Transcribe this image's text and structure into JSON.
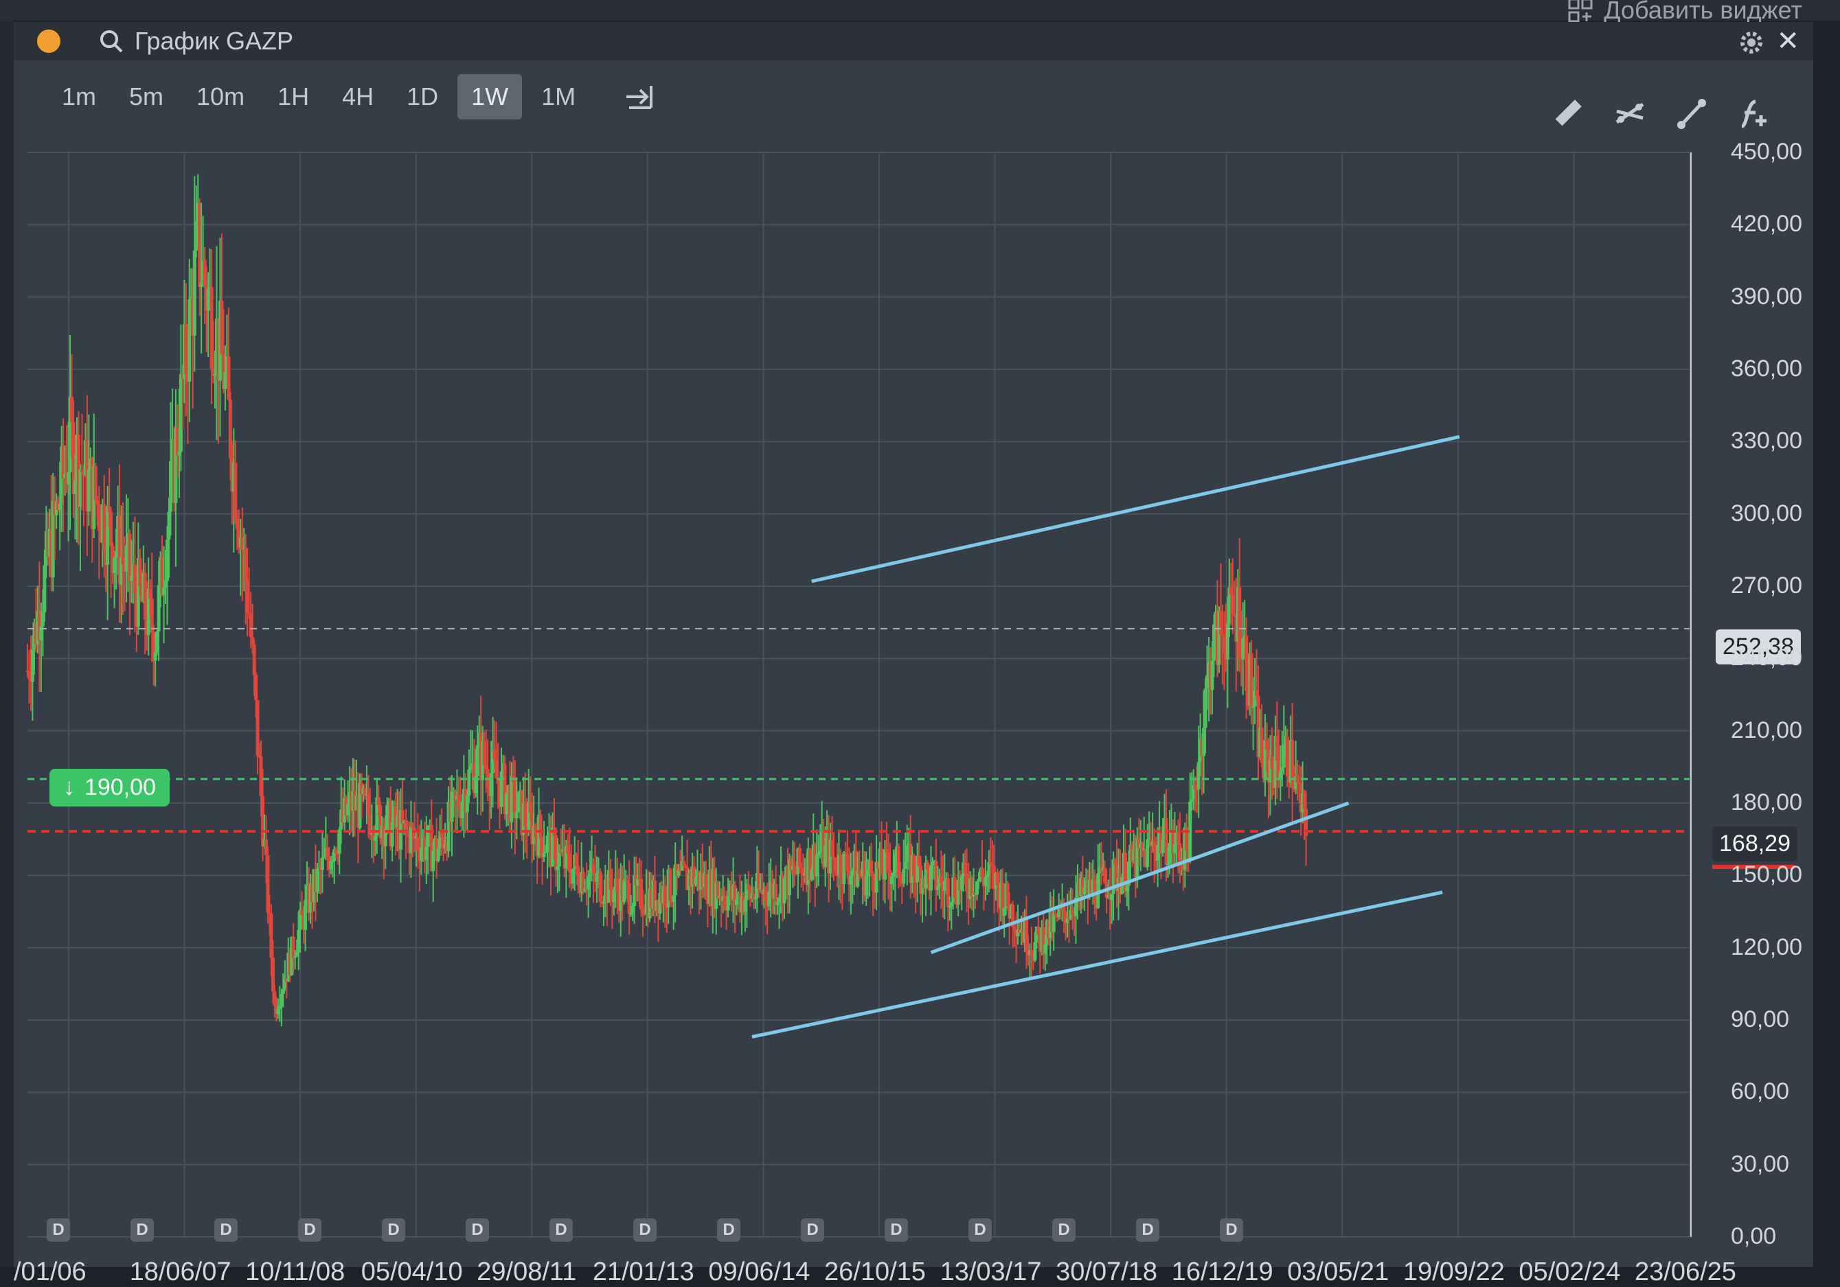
{
  "header": {
    "add_widget_label": "Добавить виджет",
    "title": "График GAZP",
    "status_color": "#f0a030"
  },
  "timeframes": [
    {
      "label": "1m",
      "active": false
    },
    {
      "label": "5m",
      "active": false
    },
    {
      "label": "10m",
      "active": false
    },
    {
      "label": "1H",
      "active": false
    },
    {
      "label": "4H",
      "active": false
    },
    {
      "label": "1D",
      "active": false
    },
    {
      "label": "1W",
      "active": true
    },
    {
      "label": "1M",
      "active": false
    }
  ],
  "tools": [
    "ruler-icon",
    "crossing-lines-icon",
    "trend-line-icon",
    "function-add-icon"
  ],
  "price_axis": {
    "ticks": [
      "450,00",
      "420,00",
      "390,00",
      "360,00",
      "330,00",
      "300,00",
      "270,00",
      "240,00",
      "210,00",
      "180,00",
      "150,00",
      "120,00",
      "90,00",
      "60,00",
      "30,00",
      "0,00"
    ]
  },
  "time_axis": {
    "ticks": [
      "/01/06",
      "18/06/07",
      "10/11/08",
      "05/04/10",
      "29/08/11",
      "21/01/13",
      "09/06/14",
      "26/10/15",
      "13/03/17",
      "30/07/18",
      "16/12/19",
      "03/05/21",
      "19/09/22",
      "05/02/24",
      "23/06/25"
    ]
  },
  "badges": {
    "last_price": "168,29",
    "cursor_price": "252,38",
    "alert_price": "190,00"
  },
  "dividend_marker_label": "D",
  "colors": {
    "up": "#4cc35e",
    "down": "#e2463a",
    "trendline": "#7ec8ea",
    "alert_line": "#3cc468",
    "last_price_line": "#e0342c"
  },
  "chart_data": {
    "type": "candlestick",
    "symbol": "GAZP",
    "interval": "1W",
    "ylim": [
      0,
      450
    ],
    "x": [
      2006.0,
      2006.5,
      2007.0,
      2007.5,
      2008.0,
      2008.3,
      2008.6,
      2008.9,
      2009.3,
      2009.8,
      2010.3,
      2010.8,
      2011.3,
      2011.8,
      2012.3,
      2012.8,
      2013.3,
      2013.8,
      2014.3,
      2014.8,
      2015.3,
      2015.8,
      2016.3,
      2016.8,
      2017.3,
      2017.8,
      2018.3,
      2018.8,
      2019.3,
      2019.6,
      2019.9,
      2020.2,
      2020.5,
      2020.8,
      2021.0
    ],
    "close": [
      235,
      330,
      290,
      250,
      410,
      360,
      260,
      95,
      140,
      180,
      170,
      160,
      200,
      175,
      155,
      145,
      140,
      150,
      140,
      145,
      160,
      150,
      155,
      145,
      150,
      120,
      140,
      150,
      165,
      160,
      245,
      260,
      195,
      200,
      168.29
    ],
    "trendlines": [
      {
        "from": {
          "x": 2015.2,
          "y": 272
        },
        "to": {
          "x": 2022.8,
          "y": 332
        }
      },
      {
        "from": {
          "x": 2014.5,
          "y": 83
        },
        "to": {
          "x": 2022.6,
          "y": 143
        }
      },
      {
        "from": {
          "x": 2016.6,
          "y": 118
        },
        "to": {
          "x": 2021.5,
          "y": 180
        }
      }
    ],
    "horizontal_levels": {
      "alert": 190.0,
      "last": 168.29,
      "cursor": 252.38
    }
  }
}
